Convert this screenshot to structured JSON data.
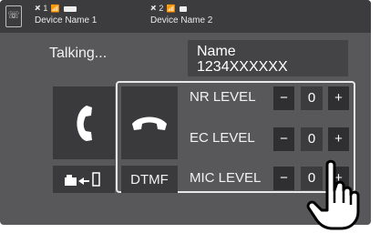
{
  "status_bar": {
    "device1": {
      "number": "1",
      "name": "Device Name 1"
    },
    "device2": {
      "number": "2",
      "name": "Device Name 2"
    }
  },
  "call": {
    "status": "Talking...",
    "caller_name": "Name",
    "caller_number": "1234XXXXXX"
  },
  "buttons": {
    "dtmf_label": "DTMF"
  },
  "levels": [
    {
      "label": "NR LEVEL",
      "minus": "−",
      "value": "0",
      "plus": "+"
    },
    {
      "label": "EC LEVEL",
      "minus": "−",
      "value": "0",
      "plus": "+"
    },
    {
      "label": "MIC LEVEL",
      "minus": "−",
      "value": "0",
      "plus": "+"
    }
  ],
  "icons": {
    "phone_device": "phone-device-icon",
    "bluetooth": "bluetooth-icon",
    "signal": "signal-icon",
    "battery": "battery-icon",
    "answer": "phone-handset-icon",
    "end": "end-call-icon",
    "transfer": "audio-transfer-icon",
    "hand": "pointing-hand-icon"
  },
  "colors": {
    "screen_bg": "#58585a",
    "status_bg": "#3c3c3e",
    "button_bg": "#3a3a3c",
    "text": "#f2f2f2"
  }
}
